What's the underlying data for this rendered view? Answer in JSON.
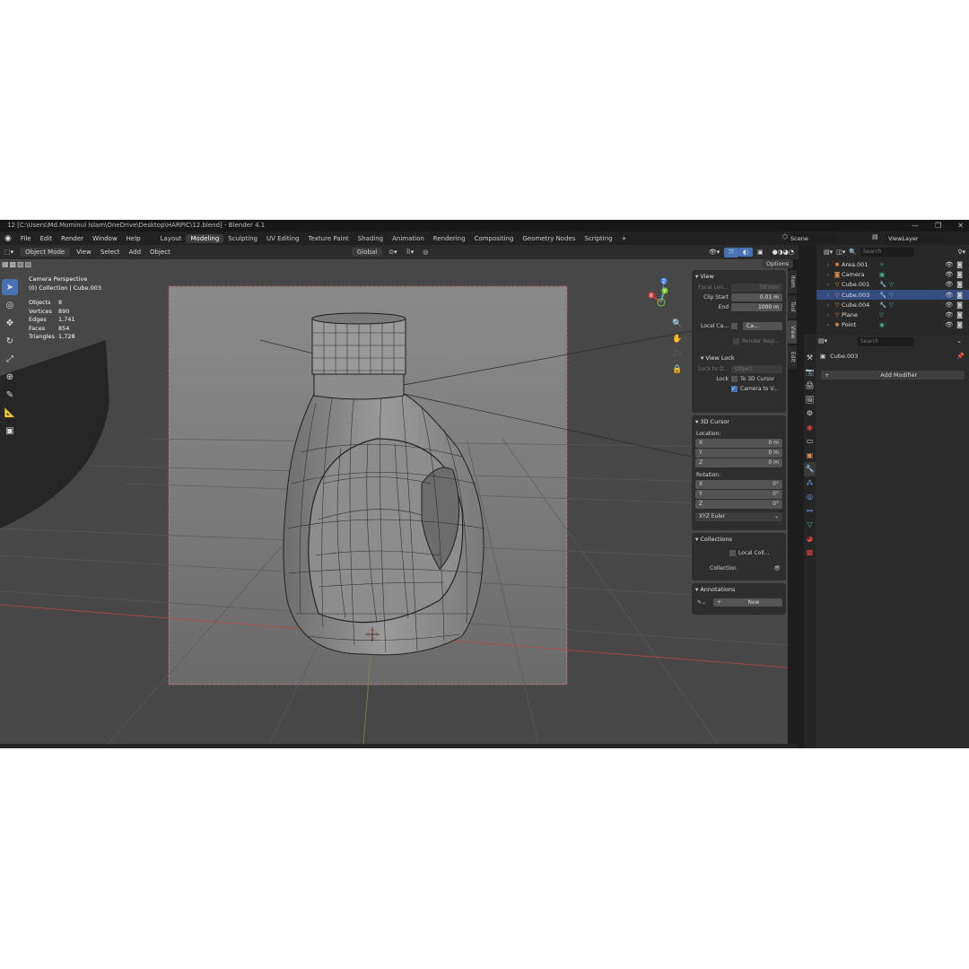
{
  "titlebar": {
    "text": "12 [C:\\Users\\Md.Mominul Islam\\OneDrive\\Desktop\\HARPIC\\12.blend] - Blender 4.1"
  },
  "menu": [
    "File",
    "Edit",
    "Render",
    "Window",
    "Help"
  ],
  "workspaces": [
    "Layout",
    "Modeling",
    "Sculpting",
    "UV Editing",
    "Texture Paint",
    "Shading",
    "Animation",
    "Rendering",
    "Compositing",
    "Geometry Nodes",
    "Scripting"
  ],
  "active_workspace": "Modeling",
  "scene": {
    "scene_name": "Scene",
    "viewlayer": "ViewLayer"
  },
  "header": {
    "mode": "Object Mode",
    "menus": [
      "View",
      "Select",
      "Add",
      "Object"
    ],
    "transform": "Global",
    "options": "Options"
  },
  "overlay_text": {
    "title": "Camera Perspective",
    "subtitle": "(0) Collection | Cube.003"
  },
  "stats": [
    {
      "k": "Objects",
      "v": "8"
    },
    {
      "k": "Vertices",
      "v": "890"
    },
    {
      "k": "Edges",
      "v": "1,741"
    },
    {
      "k": "Faces",
      "v": "854"
    },
    {
      "k": "Triangles",
      "v": "1,728"
    }
  ],
  "gizmo": {
    "x": "X",
    "y": "Y",
    "z": "Z"
  },
  "npanel": {
    "view_title": "View",
    "focal_label": "Focal Len...",
    "focal_value": "50 mm",
    "clip_start_label": "Clip Start",
    "clip_start_value": "0.01 m",
    "clip_end_label": "End",
    "clip_end_value": "1000 m",
    "local_camera_label": "Local Ca...",
    "local_camera_value": "Ca...",
    "render_region": "Render Regi...",
    "view_lock_title": "View Lock",
    "lock_to_object_label": "Lock to O...",
    "lock_object_placeholder": "Object",
    "lock_label": "Lock",
    "to_3d_cursor": "To 3D Cursor",
    "camera_to_view": "Camera to V...",
    "cursor_title": "3D Cursor",
    "location_label": "Location:",
    "loc_x_label": "X",
    "loc_x": "0 m",
    "loc_y_label": "Y",
    "loc_y": "0 m",
    "loc_z_label": "Z",
    "loc_z": "0 m",
    "rotation_label": "Rotation:",
    "rot_x_label": "X",
    "rot_x": "0°",
    "rot_y_label": "Y",
    "rot_y": "0°",
    "rot_z_label": "Z",
    "rot_z": "0°",
    "rotation_mode": "XYZ Euler",
    "collections_title": "Collections",
    "local_collections": "Local Coll...",
    "collection_name": "Collection",
    "annotations_title": "Annotations",
    "new_label": "New"
  },
  "ntabs": [
    "Item",
    "Tool",
    "View",
    "Edit"
  ],
  "outliner": {
    "search_placeholder": "Search",
    "items": [
      {
        "name": "Area.001",
        "icon": "light-icon"
      },
      {
        "name": "Camera",
        "icon": "camera-icon"
      },
      {
        "name": "Cube.001",
        "icon": "mesh-icon"
      },
      {
        "name": "Cube.003",
        "icon": "mesh-icon"
      },
      {
        "name": "Cube.004",
        "icon": "mesh-icon"
      },
      {
        "name": "Plane",
        "icon": "mesh-icon"
      },
      {
        "name": "Point",
        "icon": "light-icon"
      }
    ]
  },
  "properties": {
    "search_placeholder": "Search",
    "object_name": "Cube.003",
    "add_modifier": "Add Modifier"
  }
}
